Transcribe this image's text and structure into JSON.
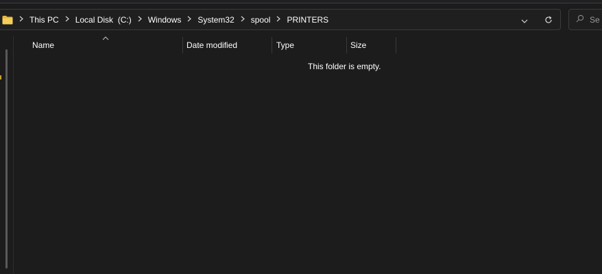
{
  "breadcrumb": {
    "items": [
      {
        "label": "This PC"
      },
      {
        "label": "Local Disk  (C:)"
      },
      {
        "label": "Windows"
      },
      {
        "label": "System32"
      },
      {
        "label": "spool"
      },
      {
        "label": "PRINTERS"
      }
    ]
  },
  "search": {
    "placeholder": "Se"
  },
  "columns": [
    {
      "label": "Name"
    },
    {
      "label": "Date modified"
    },
    {
      "label": "Type"
    },
    {
      "label": "Size"
    }
  ],
  "content": {
    "empty_message": "This folder is empty."
  },
  "icons": {
    "folder": "folder-icon",
    "separator": "chevron-right-icon",
    "dropdown": "chevron-down-icon",
    "refresh": "refresh-icon",
    "search": "search-icon",
    "sort": "sort-ascending-icon"
  },
  "colors": {
    "background": "#1c1c1c",
    "border": "#3b3b3b",
    "text": "#ffffff",
    "folder": "#f0c34a"
  }
}
